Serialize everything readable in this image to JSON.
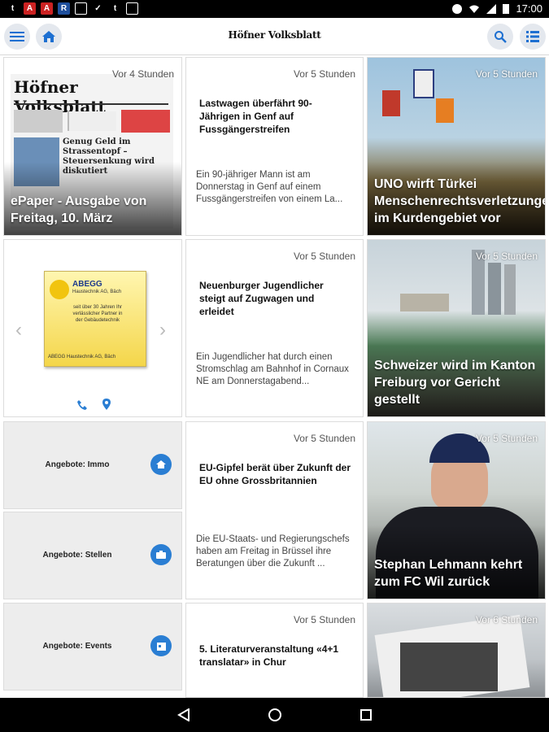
{
  "statusbar": {
    "time": "17:00"
  },
  "appbar": {
    "title": "Höfner Volksblatt"
  },
  "tiles": {
    "epaper": {
      "time": "Vor 4 Stunden",
      "title": "ePaper - Ausgabe von Freitag, 10. März",
      "masthead": "Höfner Volksblatt",
      "lead": "Genug Geld im Strassentopf – Steuersenkung wird diskutiert"
    },
    "news1": {
      "time": "Vor 5 Stunden",
      "headline": "Lastwagen überfährt 90-Jährigen in Genf auf Fussgängerstreifen",
      "teaser": "Ein 90-jähriger Mann ist am Donnerstag in Genf auf einem Fussgängerstreifen von einem La..."
    },
    "img1": {
      "time": "Vor 5 Stunden",
      "title": "UNO wirft Türkei Menschenrechtsverletzungen im Kurdengebiet vor"
    },
    "ad": {
      "company": "ABEGG",
      "subtitle": "Haustechnik AG, Bäch",
      "body": "seit über 30 Jahren Ihr verlässlicher Partner in der Gebäudetechnik",
      "footer": "ABEGG Haustechnik AG, Bäch"
    },
    "news2": {
      "time": "Vor 5 Stunden",
      "headline": "Neuenburger Jugendlicher steigt auf Zugwagen und erleidet",
      "teaser": "Ein Jugendlicher hat durch einen Stromschlag am Bahnhof in Cornaux NE am Donnerstagabend..."
    },
    "img2": {
      "time": "Vor 5 Stunden",
      "title": "Schweizer wird im Kanton Freiburg vor Gericht gestellt"
    },
    "news3": {
      "time": "Vor 5 Stunden",
      "headline": "EU-Gipfel berät über Zukunft der EU ohne Grossbritannien",
      "teaser": "Die EU-Staats- und Regierungschefs haben am Freitag in Brüssel ihre Beratungen über die Zukunft ..."
    },
    "img3": {
      "time": "Vor 5 Stunden",
      "title": "Stephan Lehmann kehrt zum FC Wil zurück"
    },
    "news4": {
      "time": "Vor 5 Stunden",
      "headline": "5. Literaturveranstaltung «4+1 translatar» in Chur"
    },
    "img4": {
      "time": "Vor 6 Stunden"
    }
  },
  "offers": [
    {
      "label": "Angebote: Immo",
      "icon": "house-icon"
    },
    {
      "label": "Angebote: Stellen",
      "icon": "briefcase-icon"
    },
    {
      "label": "Angebote: Events",
      "icon": "calendar-icon"
    }
  ],
  "colors": {
    "accent": "#2a7ed3",
    "iconbg": "#e4e8ee"
  }
}
